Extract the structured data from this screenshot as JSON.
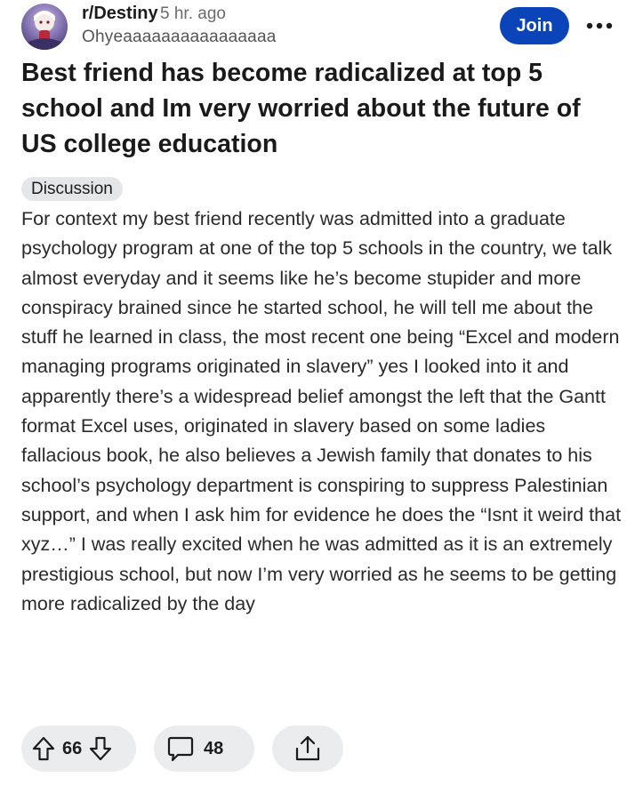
{
  "post": {
    "subreddit": "r/Destiny",
    "time_ago": "5 hr. ago",
    "username": "Ohyeaaaaaaaaaaaaaaaa",
    "join_label": "Join",
    "title": "Best friend has become radicalized at top 5 school and Im very worried about the future of US college education",
    "flair": "Discussion",
    "body": "For context my best friend recently was admitted into a graduate psychology program at one of the top 5 schools in the country, we talk almost everyday and it seems like he’s become stupider and more conspiracy brained since he started school, he will tell me about the stuff he learned in class, the most recent one being “Excel and modern managing programs originated in slavery” yes I looked into it and apparently there’s a widespread belief amongst the left that the Gantt format Excel uses, originated in slavery based on some ladies fallacious book, he also believes a Jewish family that donates to his school’s psychology department is conspiring to suppress Palestinian support, and when I ask him for evidence he does the “Isnt it weird that xyz…” I was really excited when he was admitted as it is an extremely prestigious school, but now I’m very worried as he seems to be getting more radicalized by the day"
  },
  "actions": {
    "votes": "66",
    "comments": "48"
  },
  "icons": {
    "upvote": "upvote-arrow-icon",
    "downvote": "downvote-arrow-icon",
    "comment": "comment-bubble-icon",
    "share": "share-icon",
    "more": "more-options-icon"
  },
  "colors": {
    "join_button": "#0b44b8",
    "action_pill": "#eaecee",
    "flair_bg": "#e4e6e8"
  }
}
